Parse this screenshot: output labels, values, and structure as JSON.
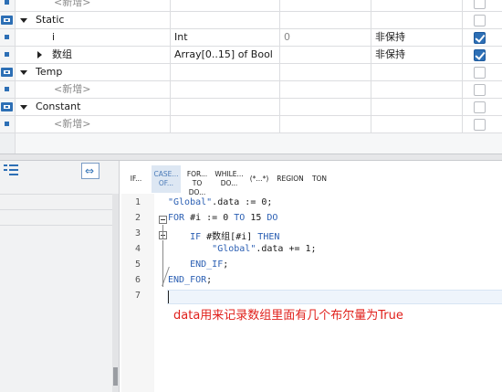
{
  "interface": {
    "rows": [
      {
        "kind": "new",
        "name": "<新增>"
      },
      {
        "kind": "section",
        "name": "Static"
      },
      {
        "kind": "var",
        "name": "i",
        "type": "Int",
        "default": "0",
        "retain": "非保持",
        "checked": true
      },
      {
        "kind": "var-expand",
        "name": "数组",
        "type": "Array[0..15] of Bool",
        "default": "",
        "retain": "非保持",
        "checked": true
      },
      {
        "kind": "section",
        "name": "Temp"
      },
      {
        "kind": "new",
        "name": "<新增>"
      },
      {
        "kind": "section",
        "name": "Constant"
      },
      {
        "kind": "new",
        "name": "<新增>"
      }
    ]
  },
  "left_pane": {
    "toolbar": {
      "list_icon": "list-indent-icon",
      "toggle_icon": "swap-view-icon"
    }
  },
  "scl_toolbar": {
    "buttons": [
      {
        "line1": "IF...",
        "line2": ""
      },
      {
        "line1": "CASE...",
        "line2": "OF..."
      },
      {
        "line1": "FOR...",
        "line2": "TO DO..."
      },
      {
        "line1": "WHILE...",
        "line2": "DO..."
      },
      {
        "line1": "(*...*)",
        "line2": ""
      },
      {
        "line1": "REGION",
        "line2": ""
      },
      {
        "line1": "TON",
        "line2": ""
      }
    ]
  },
  "code": {
    "line_numbers": [
      "1",
      "2",
      "3",
      "4",
      "5",
      "6",
      "7"
    ],
    "lines": [
      {
        "indent": "",
        "tokens": [
          {
            "t": "\"Global\"",
            "c": "str"
          },
          {
            "t": ".data := 0;",
            "c": ""
          }
        ]
      },
      {
        "indent": "",
        "tokens": [
          {
            "t": "FOR",
            "c": "kw"
          },
          {
            "t": " #i := 0 ",
            "c": ""
          },
          {
            "t": "TO",
            "c": "kw"
          },
          {
            "t": " 15 ",
            "c": ""
          },
          {
            "t": "DO",
            "c": "kw"
          }
        ]
      },
      {
        "indent": "    ",
        "tokens": [
          {
            "t": "IF",
            "c": "kw"
          },
          {
            "t": " #数组[#i] ",
            "c": ""
          },
          {
            "t": "THEN",
            "c": "kw"
          }
        ]
      },
      {
        "indent": "        ",
        "tokens": [
          {
            "t": "\"Global\"",
            "c": "str"
          },
          {
            "t": ".data += 1;",
            "c": ""
          }
        ]
      },
      {
        "indent": "    ",
        "tokens": [
          {
            "t": "END_IF",
            "c": "kw"
          },
          {
            "t": ";",
            "c": ""
          }
        ]
      },
      {
        "indent": "",
        "tokens": [
          {
            "t": "END_FOR",
            "c": "kw"
          },
          {
            "t": ";",
            "c": ""
          }
        ]
      },
      {
        "indent": "",
        "tokens": []
      }
    ]
  },
  "annotation": "data用来记录数组里面有几个布尔量为True",
  "colors": {
    "accent": "#2d6fb5",
    "keyword": "#2b5fb3",
    "annotation": "#e0201b"
  }
}
